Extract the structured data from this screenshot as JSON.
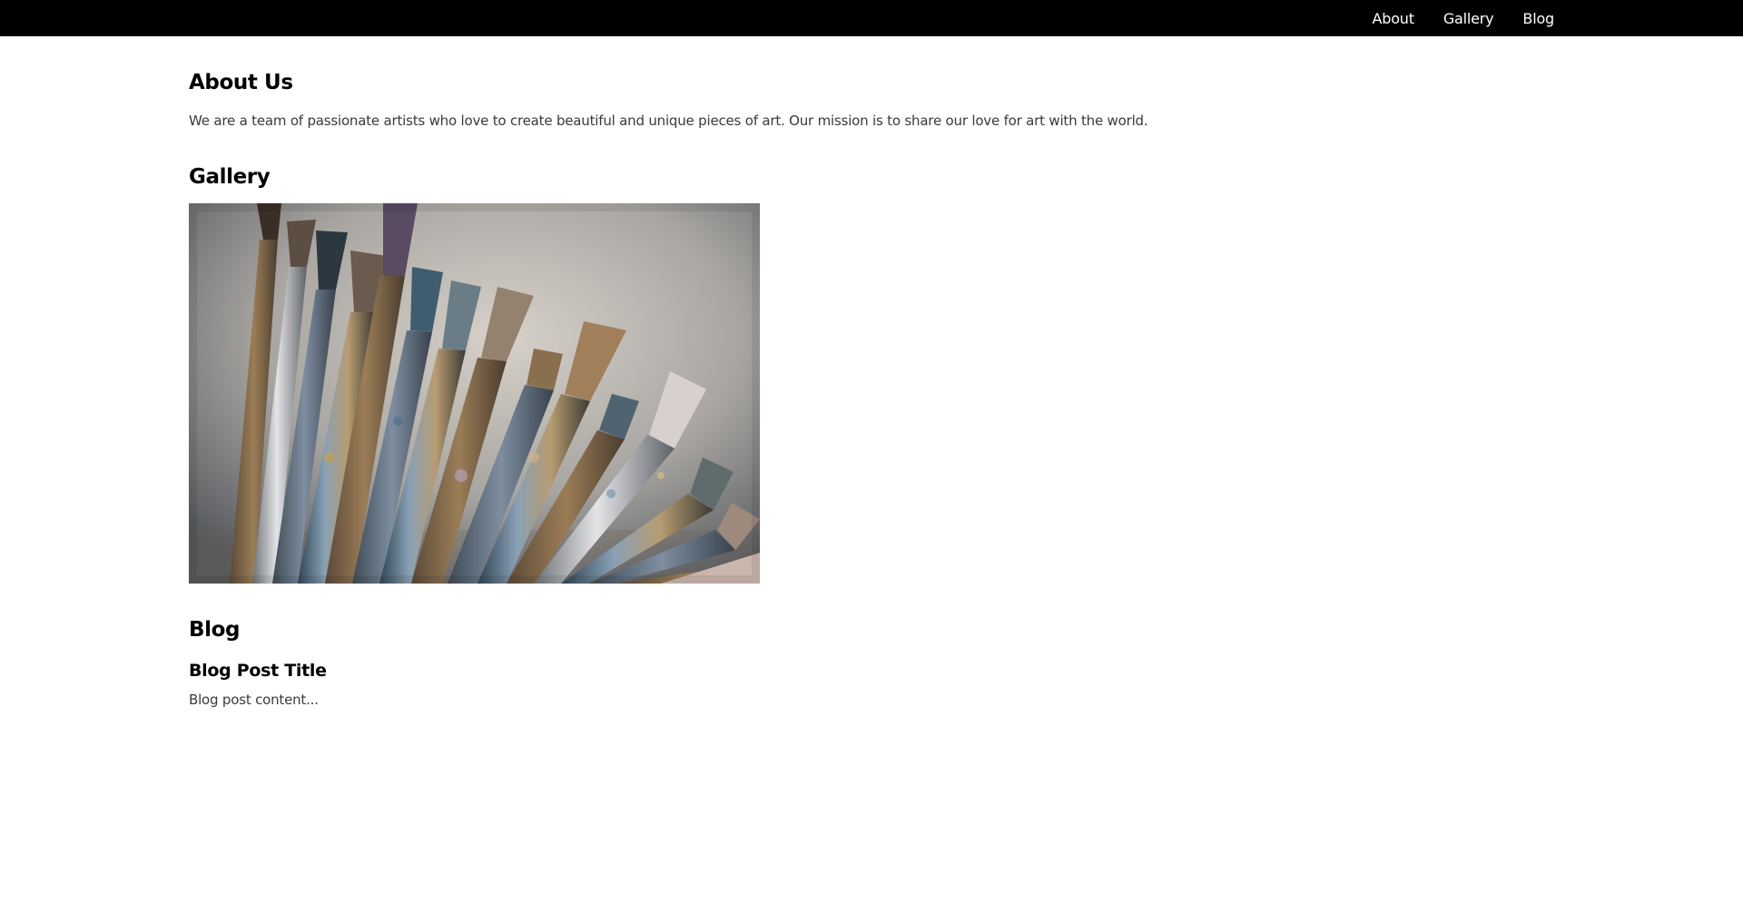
{
  "nav": {
    "items": [
      {
        "label": "About"
      },
      {
        "label": "Gallery"
      },
      {
        "label": "Blog"
      }
    ]
  },
  "about": {
    "title": "About Us",
    "text": "We are a team of passionate artists who love to create beautiful and unique pieces of art. Our mission is to share our love for art with the world."
  },
  "gallery": {
    "title": "Gallery",
    "image_subject": "paintbrushes"
  },
  "blog": {
    "title": "Blog",
    "post_title": "Blog Post Title",
    "post_content": "Blog post content..."
  },
  "colors": {
    "topbar_bg": "#000000",
    "nav_text": "#ffffff",
    "body_text": "#3a3a3a",
    "heading_text": "#000000"
  }
}
